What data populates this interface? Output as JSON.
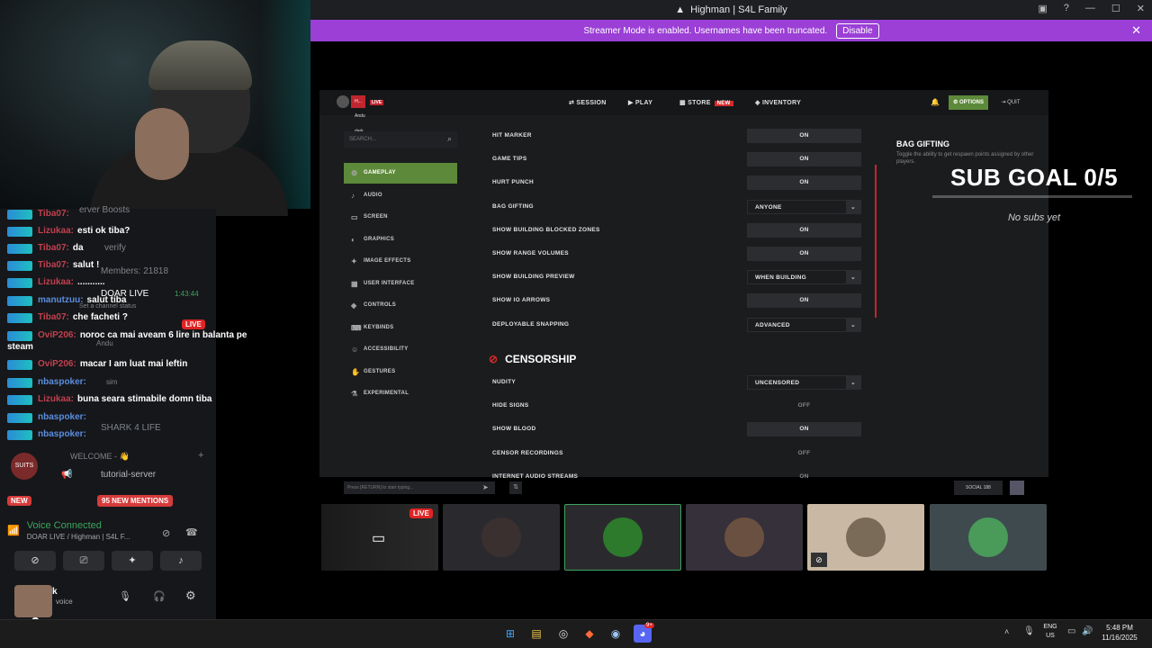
{
  "window": {
    "title": "Highman | S4L Family"
  },
  "streamer_banner": {
    "text": "Streamer Mode is enabled. Usernames have been truncated.",
    "button": "Disable"
  },
  "chat": [
    {
      "user": "Tiba07:",
      "msg": "",
      "color": "#c0404f"
    },
    {
      "user": "Lizukaa:",
      "msg": "esti ok tiba?",
      "color": "#c0404f"
    },
    {
      "user": "Tiba07:",
      "msg": "da",
      "color": "#c0404f"
    },
    {
      "user": "Tiba07:",
      "msg": "salut !",
      "color": "#c0404f"
    },
    {
      "user": "Lizukaa:",
      "msg": "...........",
      "color": "#c0404f"
    },
    {
      "user": "manutzuu:",
      "msg": "salut tiba",
      "color": "#5b8ee0"
    },
    {
      "user": "Tiba07:",
      "msg": "che facheti ?",
      "color": "#c0404f"
    },
    {
      "user": "OviP206:",
      "msg": "noroc ca mai aveam 6 lire in balanta pe",
      "color": "#c0404f"
    },
    {
      "user": "",
      "msg": "steam",
      "color": "#c0404f"
    },
    {
      "user": "OviP206:",
      "msg": "macar I am luat mai leftin",
      "color": "#c0404f"
    },
    {
      "user": "nbaspoker:",
      "msg": "",
      "color": "#5b8ee0"
    },
    {
      "user": "Lizukaa:",
      "msg": "buna seara stimabile domn tiba",
      "color": "#c0404f"
    },
    {
      "user": "nbaspoker:",
      "msg": "",
      "color": "#5b8ee0"
    },
    {
      "user": "nbaspoker:",
      "msg": "",
      "color": "#5b8ee0"
    }
  ],
  "discord": {
    "verify": "verify",
    "members": "Members: 21818",
    "channel_name": "DOAR LIVE",
    "channel_time": "1:43:44",
    "channel_status": "Set a channel status",
    "live": "LIVE",
    "user1": "Andu",
    "user2": "sim",
    "user3": "SHARK 4 LIFE",
    "welcome": "WELCOME - 👋",
    "tutorial": "tutorial-server",
    "new_badge": "NEW",
    "mentions": "95 NEW MENTIONS",
    "voice_connected": "Voice Connected",
    "voice_channel": "DOAR LIVE / Highman | S4L F...",
    "username": "k",
    "user_status": "voice",
    "server_boosts": "erver Boosts"
  },
  "game": {
    "nav": [
      "SESSION",
      "PLAY",
      "STORE",
      "INVENTORY"
    ],
    "new_tag": "NEW",
    "options": "OPTIONS",
    "quit": "QUIT",
    "search_placeholder": "SEARCH...",
    "live": "LIVE",
    "party": [
      "H...",
      "Andu",
      "dark"
    ],
    "categories": [
      "GAMEPLAY",
      "AUDIO",
      "SCREEN",
      "GRAPHICS",
      "IMAGE EFFECTS",
      "USER INTERFACE",
      "CONTROLS",
      "KEYBINDS",
      "ACCESSIBILITY",
      "GESTURES",
      "EXPERIMENTAL"
    ],
    "settings": [
      {
        "label": "HIT MARKER",
        "value": "ON",
        "kind": "toggle"
      },
      {
        "label": "GAME TIPS",
        "value": "ON",
        "kind": "toggle"
      },
      {
        "label": "HURT PUNCH",
        "value": "ON",
        "kind": "toggle"
      },
      {
        "label": "BAG GIFTING",
        "value": "ANYONE",
        "kind": "drop"
      },
      {
        "label": "SHOW BUILDING BLOCKED ZONES",
        "value": "ON",
        "kind": "toggle"
      },
      {
        "label": "SHOW RANGE VOLUMES",
        "value": "ON",
        "kind": "toggle"
      },
      {
        "label": "SHOW BUILDING PREVIEW",
        "value": "WHEN BUILDING",
        "kind": "drop"
      },
      {
        "label": "SHOW IO ARROWS",
        "value": "ON",
        "kind": "toggle"
      },
      {
        "label": "DEPLOYABLE SNAPPING",
        "value": "ADVANCED",
        "kind": "drop"
      }
    ],
    "censorship_title": "CENSORSHIP",
    "censor_settings": [
      {
        "label": "NUDITY",
        "value": "UNCENSORED",
        "kind": "drop"
      },
      {
        "label": "HIDE SIGNS",
        "value": "OFF",
        "kind": "plain"
      },
      {
        "label": "SHOW BLOOD",
        "value": "ON",
        "kind": "toggle"
      },
      {
        "label": "CENSOR RECORDINGS",
        "value": "OFF",
        "kind": "plain"
      },
      {
        "label": "INTERNET AUDIO STREAMS",
        "value": "ON",
        "kind": "plain"
      }
    ],
    "info_title": "BAG GIFTING",
    "info_desc": "Toggle the ability to get respawn points assigned by other players.",
    "chat_placeholder": "Press [RETURN] to start typing...",
    "social": "SOCIAL",
    "social_count": "188"
  },
  "overlay": {
    "sub_goal": "SUB GOAL 0/5",
    "no_subs": "No subs yet"
  },
  "taskbar": {
    "lang": "ENG",
    "region": "US",
    "time": "5:48 PM",
    "date": "11/16/2025",
    "discord_badge": "9+"
  },
  "colors": {
    "accent_green": "#5d8a3a",
    "streamer_purple": "#9b3fd6",
    "live_red": "#e02424",
    "voice_green": "#3ba55d"
  }
}
